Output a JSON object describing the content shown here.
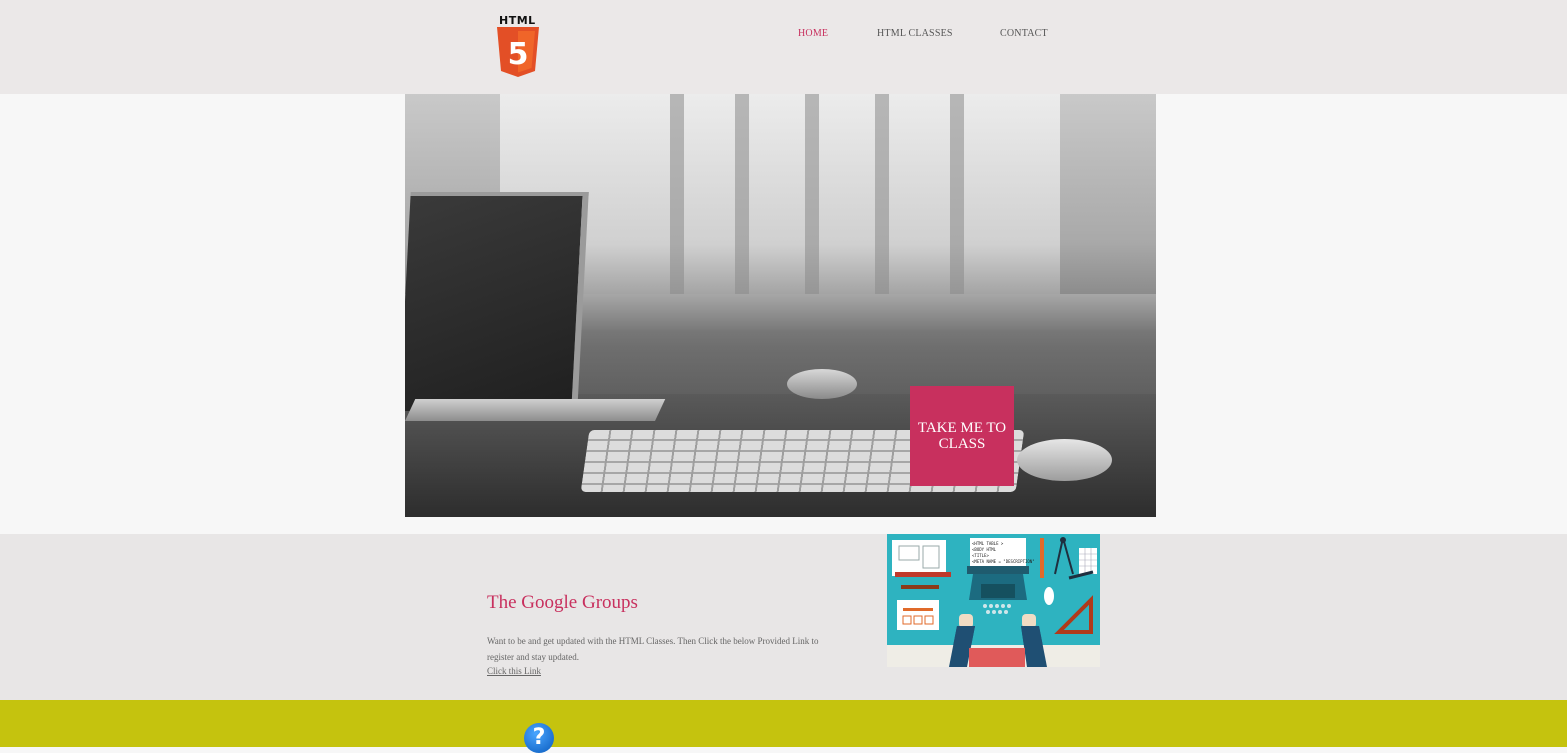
{
  "header": {
    "logo_text": "HTML",
    "logo_numeral": "5",
    "nav": [
      {
        "label": "HOME",
        "active": true
      },
      {
        "label": "HTML CLASSES",
        "active": false
      },
      {
        "label": "CONTACT",
        "active": false
      }
    ]
  },
  "hero": {
    "cta_label": "TAKE ME TO CLASS"
  },
  "groups": {
    "title": "The Google Groups",
    "description": "Want to be and get updated with the HTML Classes. Then Click the below Provided Link to register and stay updated.",
    "link_label": "Click this Link",
    "illustration_code_lines": [
      "<HTML TABLE >",
      "<BODY HTML",
      "<TITLE>",
      "<META NAME = \"DESCRIPTION\""
    ]
  },
  "footer": {
    "help_icon": "question-circle-icon",
    "help_glyph": "?"
  },
  "colors": {
    "accent": "#c8305e",
    "header_bg": "#ebe8e8",
    "footer_bg": "#c5c30e",
    "html5_orange": "#e34f26"
  }
}
